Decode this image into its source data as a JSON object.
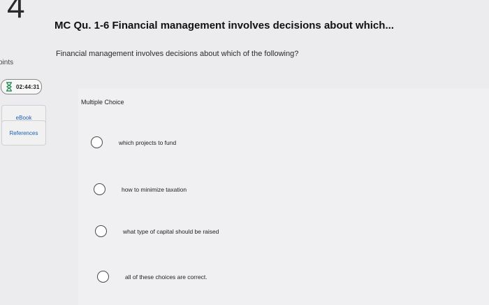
{
  "question": {
    "number": "4",
    "points_label": "oints",
    "timer": "02:44:31",
    "title": "MC Qu. 1-6 Financial management involves decisions about which...",
    "prompt": "Financial management involves decisions about which of the following?",
    "type_label": "Multiple Choice"
  },
  "sidebar": {
    "ebook_label": "eBook",
    "references_label": "References"
  },
  "options": [
    {
      "label": "which projects to fund"
    },
    {
      "label": "how to minimize taxation"
    },
    {
      "label": "what type of capital should be raised"
    },
    {
      "label": "all of these choices are correct."
    }
  ],
  "icons": {
    "timer": "hourglass-icon"
  }
}
